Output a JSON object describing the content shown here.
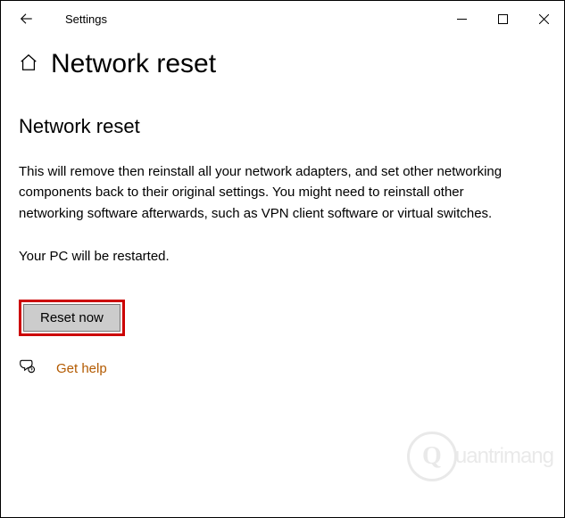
{
  "titlebar": {
    "app_title": "Settings"
  },
  "header": {
    "page_title": "Network reset"
  },
  "main": {
    "section_title": "Network reset",
    "description": "This will remove then reinstall all your network adapters, and set other networking components back to their original settings. You might need to reinstall other networking software afterwards, such as VPN client software or virtual switches.",
    "restart_notice": "Your PC will be restarted.",
    "reset_button_label": "Reset now",
    "help_link_label": "Get help"
  },
  "watermark": {
    "letter": "Q",
    "text": "uantrimang"
  }
}
